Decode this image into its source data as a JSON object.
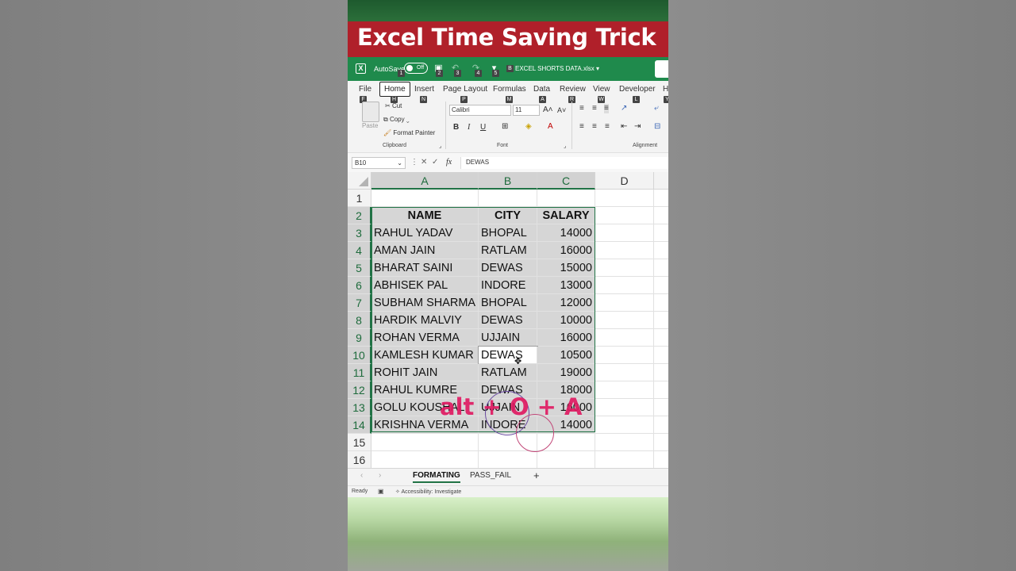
{
  "banner": {
    "title": "Excel Time Saving Trick"
  },
  "titlebar": {
    "autosave_label": "AutoSave",
    "autosave_state": "Off",
    "file_name": "EXCEL SHORTS DATA.xlsx",
    "keytips": {
      "autosave": "1",
      "save": "2",
      "undo": "3",
      "redo": "4",
      "qat": "5",
      "file": "B"
    }
  },
  "ribbon_tabs": {
    "tabs": [
      "File",
      "Home",
      "Insert",
      "Page Layout",
      "Formulas",
      "Data",
      "Review",
      "View",
      "Developer",
      "H"
    ],
    "keytips": [
      "F",
      "H",
      "N",
      "P",
      "M",
      "A",
      "R",
      "W",
      "L",
      "Y"
    ]
  },
  "ribbon": {
    "paste": "Paste",
    "cut": "Cut",
    "copy": "Copy",
    "format_painter": "Format Painter",
    "clipboard": "Clipboard",
    "font_name": "Calibri",
    "font_size": "11",
    "font": "Font",
    "alignment": "Alignment",
    "bold": "B",
    "italic": "I",
    "underline": "U"
  },
  "formula_bar": {
    "name_box": "B10",
    "fx": "fx",
    "value": "DEWAS"
  },
  "grid": {
    "columns": [
      "A",
      "B",
      "C",
      "D"
    ],
    "rows": [
      "1",
      "2",
      "3",
      "4",
      "5",
      "6",
      "7",
      "8",
      "9",
      "10",
      "11",
      "12",
      "13",
      "14",
      "15",
      "16"
    ],
    "table": {
      "headers": [
        "NAME",
        "CITY",
        "SALARY"
      ],
      "records": [
        [
          "RAHUL YADAV",
          "BHOPAL",
          "14000"
        ],
        [
          "AMAN JAIN",
          "RATLAM",
          "16000"
        ],
        [
          "BHARAT SAINI",
          "DEWAS",
          "15000"
        ],
        [
          "ABHISEK PAL",
          "INDORE",
          "13000"
        ],
        [
          "SUBHAM SHARMA",
          "BHOPAL",
          "12000"
        ],
        [
          "HARDIK MALVIY",
          "DEWAS",
          "10000"
        ],
        [
          "ROHAN VERMA",
          "UJJAIN",
          "16000"
        ],
        [
          "KAMLESH KUMAR",
          "DEWAS",
          "10500"
        ],
        [
          "ROHIT JAIN",
          "RATLAM",
          "19000"
        ],
        [
          "RAHUL KUMRE",
          "DEWAS",
          "18000"
        ],
        [
          "GOLU KOUSHAL",
          "UJJAIN",
          "16000"
        ],
        [
          "KRISHNA VERMA",
          "INDORE",
          "14000"
        ]
      ]
    }
  },
  "overlay": {
    "shortcut": "alt + O + A"
  },
  "sheets": {
    "tabs": [
      "FORMATING",
      "PASS_FAIL"
    ],
    "add": "+",
    "prev": "‹",
    "next": "›"
  },
  "status": {
    "ready": "Ready",
    "accessibility": "Accessibility: Investigate"
  },
  "colors": {
    "excel_green": "#217346",
    "banner_red": "#b0202a",
    "overlay_pink": "#e01b63"
  }
}
